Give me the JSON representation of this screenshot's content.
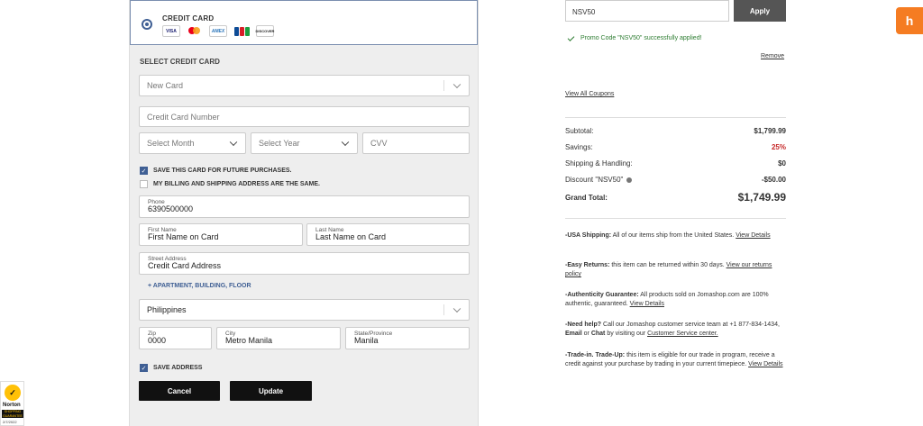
{
  "payment": {
    "method_label": "CREDIT CARD",
    "card_logos": [
      "VISA",
      "mastercard",
      "AMEX",
      "JCB",
      "DISCOVER"
    ],
    "section_title": "SELECT CREDIT CARD",
    "card_select": "New Card",
    "card_number_placeholder": "Credit Card Number",
    "month_placeholder": "Select Month",
    "year_placeholder": "Select Year",
    "cvv_placeholder": "CVV",
    "save_card_label": "SAVE THIS CARD FOR FUTURE PURCHASES.",
    "save_card_checked": true,
    "same_address_label": "MY BILLING AND SHIPPING ADDRESS ARE THE SAME.",
    "same_address_checked": false,
    "phone": {
      "label": "Phone",
      "value": "6390500000"
    },
    "first_name": {
      "label": "First Name",
      "value": "First Name on Card"
    },
    "last_name": {
      "label": "Last Name",
      "value": "Last Name on Card"
    },
    "street": {
      "label": "Street Address",
      "value": "Credit Card Address"
    },
    "add_line_link": "+ APARTMENT, BUILDING, FLOOR",
    "country": "Philippines",
    "zip": {
      "label": "Zip",
      "value": "0000"
    },
    "city": {
      "label": "City",
      "value": "Metro Manila"
    },
    "state": {
      "label": "State/Province",
      "value": "Manila"
    },
    "save_address_label": "SAVE ADDRESS",
    "save_address_checked": true,
    "cancel_label": "Cancel",
    "update_label": "Update"
  },
  "summary": {
    "promo_value": "NSV50",
    "apply_label": "Apply",
    "promo_message": "Promo Code \"NSV50\" successfully applied!",
    "remove_label": "Remove",
    "coupons_label": "View All Coupons",
    "subtotal": {
      "label": "Subtotal:",
      "value": "$1,799.99"
    },
    "savings": {
      "label": "Savings:",
      "value": "25%"
    },
    "shipping": {
      "label": "Shipping & Handling:",
      "value": "$0"
    },
    "discount": {
      "label": "Discount \"NSV50\"",
      "value": "-$50.00"
    },
    "grand_total": {
      "label": "Grand Total:",
      "value": "$1,749.99"
    },
    "notes": [
      {
        "title": "-USA Shipping:",
        "text": " All of our items ship from the United States. ",
        "link": "View Details"
      },
      {
        "title": "-Easy Returns:",
        "text": " this item can be returned within 30 days. ",
        "link": "View our returns policy"
      },
      {
        "title": "-Authenticity Guarantee:",
        "text": " All products sold on Jomashop.com are 100% authentic, guaranteed. ",
        "link": "View Details"
      },
      {
        "title": "-Need help?",
        "text": " Call our Jomashop customer service team at +1 877-834-1434, ",
        "bold2": "Email",
        "mid": " or ",
        "bold3": "Chat",
        "text2": " by visiting our ",
        "link": "Customer Service center."
      },
      {
        "title": "-Trade-in. Trade-Up:",
        "text": " this item is eligible for our trade in program, receive a credit against your purchase by trading in your current timepiece. ",
        "link": "View Details"
      }
    ]
  },
  "badge": {
    "name": "Norton",
    "sub": "SHOPPING GUARANTEE",
    "date": "2/7/2022"
  },
  "colors": {
    "accent": "#3f5f94",
    "success": "#2e7d32",
    "savings_red": "#c62828",
    "helper_orange": "#f57c22"
  }
}
